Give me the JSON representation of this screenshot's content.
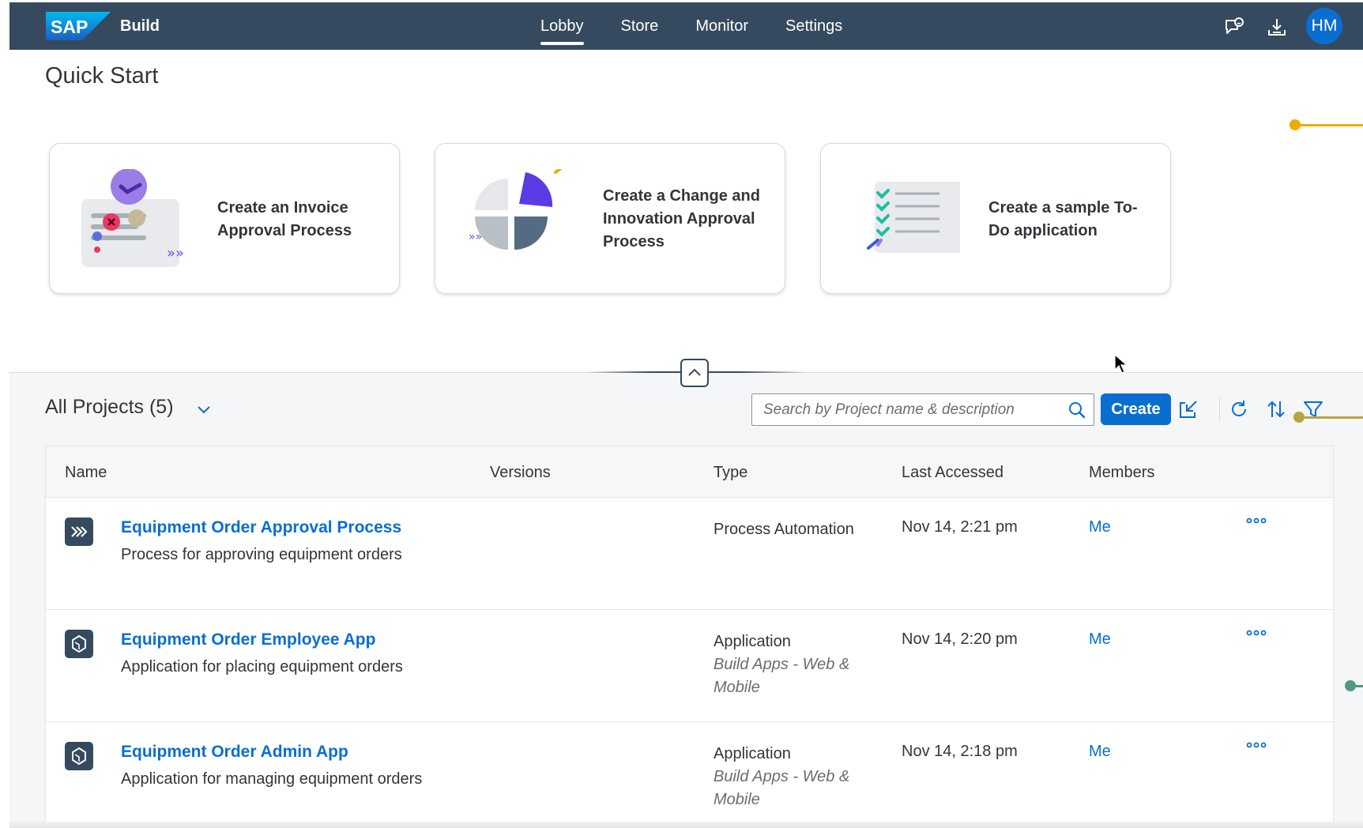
{
  "shell": {
    "logo_text": "SAP",
    "product": "Build",
    "nav": [
      {
        "label": "Lobby",
        "active": true
      },
      {
        "label": "Store",
        "active": false
      },
      {
        "label": "Monitor",
        "active": false
      },
      {
        "label": "Settings",
        "active": false
      }
    ],
    "icons": [
      "feedback-icon",
      "download-icon"
    ],
    "avatar_initials": "HM"
  },
  "quick_start": {
    "title": "Quick Start",
    "cards": [
      {
        "title": "Create an Invoice Approval Process",
        "illustration": "invoice-illustration"
      },
      {
        "title": "Create a Change and Innovation Approval Process",
        "illustration": "pie-illustration"
      },
      {
        "title": "Create a sample To-Do application",
        "illustration": "todo-illustration"
      }
    ]
  },
  "projects": {
    "title": "All Projects (5)",
    "search_placeholder": "Search by Project name & description",
    "create_label": "Create",
    "columns": [
      "Name",
      "Versions",
      "Type",
      "Last Accessed",
      "Members"
    ],
    "rows": [
      {
        "icon": "process-automation-icon",
        "name": "Equipment Order Approval Process",
        "description": "Process for approving equipment orders",
        "type": "Process Automation",
        "type_sub": "",
        "last_accessed": "Nov 14, 2:21 pm",
        "members": "Me"
      },
      {
        "icon": "application-icon",
        "name": "Equipment Order Employee App",
        "description": "Application for placing equipment orders",
        "type": "Application",
        "type_sub": "Build Apps - Web & Mobile",
        "last_accessed": "Nov 14, 2:20 pm",
        "members": "Me"
      },
      {
        "icon": "application-icon",
        "name": "Equipment Order Admin App",
        "description": "Application for managing equipment orders",
        "type": "Application",
        "type_sub": "Build Apps - Web & Mobile",
        "last_accessed": "Nov 14, 2:18 pm",
        "members": "Me"
      }
    ]
  },
  "colors": {
    "shell": "#354a5f",
    "accent": "#0a6ed1",
    "deco_orange": "#f0ab00",
    "deco_olive": "#b5a642",
    "deco_green": "#4a9b7f"
  }
}
